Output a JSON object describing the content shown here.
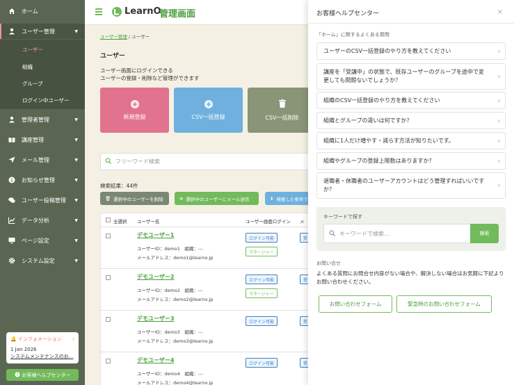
{
  "header": {
    "brand": "LearnO",
    "brand_sub": "管理画面"
  },
  "sidebar": {
    "items": [
      {
        "label": "ホーム",
        "icon": "home-icon"
      },
      {
        "label": "ユーザー管理",
        "icon": "user-icon"
      },
      {
        "label": "管理者管理",
        "icon": "admin-icon"
      },
      {
        "label": "講座管理",
        "icon": "book-icon"
      },
      {
        "label": "メール管理",
        "icon": "send-icon"
      },
      {
        "label": "お知らせ管理",
        "icon": "info-icon"
      },
      {
        "label": "ユーザー投稿管理",
        "icon": "chat-icon"
      },
      {
        "label": "データ分析",
        "icon": "chart-icon"
      },
      {
        "label": "ページ設定",
        "icon": "monitor-icon"
      },
      {
        "label": "システム設定",
        "icon": "gear-icon"
      }
    ],
    "sub_items": [
      "ユーザー",
      "組織",
      "グループ",
      "ログイン中ユーザー"
    ],
    "info": {
      "title": "インフォメーション",
      "date": "1 Jan 2026",
      "text": "システムメンテナンスのお..."
    },
    "help_button": "お客様ヘルプセンター"
  },
  "main": {
    "breadcrumb": {
      "link": "ユーザー管理",
      "sep": " / ",
      "current": "ユーザー"
    },
    "title": "ユーザー",
    "desc1": "ユーザー画面にログインできる",
    "desc2": "ユーザーの登録・削除など管理ができます",
    "cards": [
      {
        "label": "新規登録",
        "color": "#e2738f"
      },
      {
        "label": "CSV一括登録",
        "color": "#6fb0df"
      },
      {
        "label": "CSV一括削除",
        "color": "#8a9577"
      }
    ],
    "search_placeholder": "フリーワード検索",
    "results": "検索結果：44件",
    "actions": [
      {
        "label": "選択中のユーザーを削除",
        "color": "#7b8673"
      },
      {
        "label": "選択中のユーザーにメール送信",
        "color": "#72ba5b"
      },
      {
        "label": "検索した条件で",
        "color": "#6fb0df"
      }
    ],
    "table": {
      "headers": {
        "select_all": "全選択",
        "username": "ユーザー名",
        "login": "ユーザー画面ログイン",
        "extra": "メ"
      },
      "rows": [
        {
          "name": "デモユーザー1",
          "meta1": "ユーザーID：demo1　組織：---",
          "meta2": "メールアドレス：demo1@learno.jp",
          "login": "ログイン可能",
          "role": "マネージャー",
          "extra": "受"
        },
        {
          "name": "デモユーザー2",
          "meta1": "ユーザーID：demo2　組織：---",
          "meta2": "メールアドレス：demo2@learno.jp",
          "login": "ログイン可能",
          "role": "マネージャー",
          "extra": "受"
        },
        {
          "name": "デモユーザー3",
          "meta1": "ユーザーID：demo3　組織：---",
          "meta2": "メールアドレス：demo3@learno.jp",
          "login": "ログイン可能",
          "role": "",
          "extra": "受"
        },
        {
          "name": "デモユーザー4",
          "meta1": "ユーザーID：demo4　組織：---",
          "meta2": "メールアドレス：demo4@learno.jp",
          "login": "ログイン可能",
          "role": "",
          "extra": "受"
        }
      ]
    }
  },
  "help": {
    "title": "お客様ヘルプセンター",
    "close": "×",
    "faq_heading": "「ホーム」に関するよくある質問",
    "faqs": [
      "ユーザーのCSV一括登録のやり方を教えてください",
      "講座を「受講中」の状態で、既存ユーザーのグループを途中で変更しても問題ないでしょうか？",
      "組織のCSV一括登録のやり方を教えてください",
      "組織とグループの違いは何ですか？",
      "組織に1人だけ増やす・減らす方法が知りたいです。",
      "組織やグループの登録上限数はありますか？",
      "退職者・休職者のユーザーアカウントはどう管理すればいいですか？"
    ],
    "keyword_label": "キーワードで探す",
    "keyword_placeholder": "キーワードで検索...",
    "search_button": "検索",
    "contact_heading": "お問い合せ",
    "contact_text": "よくある質問にお問合せ内容がない場合や、解決しない場合はお気軽に下記よりお問い合わせください。",
    "contact_button": "お問い合わせフォーム",
    "urgent_button": "緊急時のお問い合わせフォーム"
  }
}
